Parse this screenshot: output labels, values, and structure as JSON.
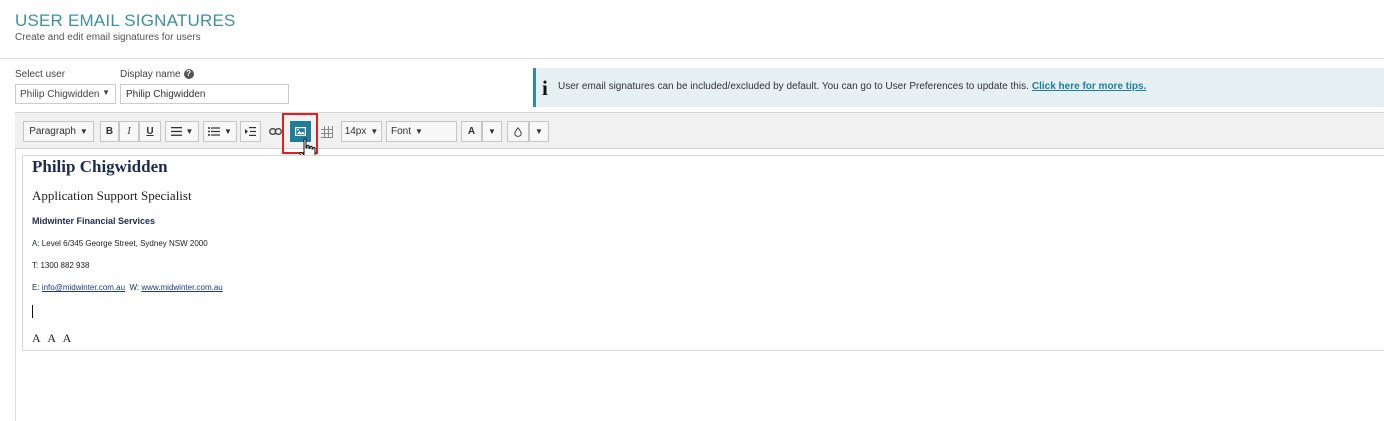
{
  "page": {
    "title": "USER EMAIL SIGNATURES",
    "subtitle": "Create and edit email signatures for users"
  },
  "form": {
    "select_user_label": "Select user",
    "selected_user": "Philip Chigwidden",
    "display_name_label": "Display name",
    "display_name_value": "Philip Chigwidden"
  },
  "info_banner": {
    "text": "User email signatures can be included/excluded by default. You can go to User Preferences to update this.",
    "link": "Click here for more tips."
  },
  "toolbar": {
    "paragraph": "Paragraph",
    "bold": "B",
    "italic": "I",
    "underline": "U",
    "font_size": "14px",
    "font": "Font",
    "text_color": "A",
    "active_button": "insert-image"
  },
  "signature": {
    "name": "Philip Chigwidden",
    "title": "Application Support Specialist",
    "company": "Midwinter Financial Services",
    "address_key": "A:",
    "address": "Level 6/345 George Street, Sydney NSW 2000",
    "phone_key": "T:",
    "phone": "1300 882 938",
    "email_key": "E:",
    "email": "info@midwinter.com.au",
    "web_key": "W:",
    "website": "www.midwinter.com.au",
    "social": "A A A"
  },
  "colors": {
    "accent": "#3f8fa3",
    "link": "#1c7fa0",
    "active_button": "#1f7e93",
    "highlight": "#e11f1f",
    "name": "#1d2c4c"
  }
}
